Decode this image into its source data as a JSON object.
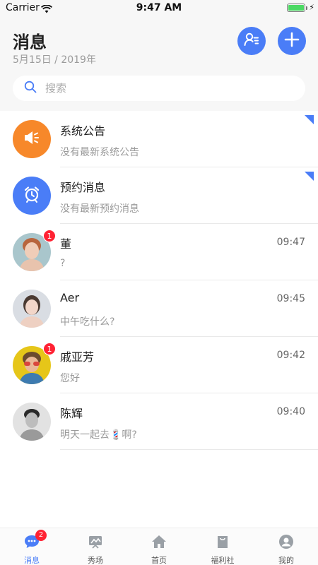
{
  "status_bar": {
    "carrier": "Carrier",
    "time": "9:47 AM"
  },
  "header": {
    "title": "消息",
    "date": "5月15日 / 2019年",
    "contacts_icon": "contacts-icon",
    "add_icon": "plus-icon",
    "accent_color": "#4a7df7"
  },
  "search": {
    "placeholder": "搜索",
    "value": ""
  },
  "conversations": [
    {
      "name": "系统公告",
      "preview": "没有最新系统公告",
      "time": "",
      "badge": "",
      "icon": "megaphone-icon",
      "avatar_color": "#f7882a",
      "corner_tag": true
    },
    {
      "name": "预约消息",
      "preview": "没有最新预约消息",
      "time": "",
      "badge": "",
      "icon": "alarm-clock-icon",
      "avatar_color": "#4a7df7",
      "corner_tag": true
    },
    {
      "name": "董",
      "preview": "?",
      "time": "09:47",
      "badge": "1",
      "icon": "user-avatar",
      "avatar_color": "#a9c6cc"
    },
    {
      "name": "Aer",
      "preview": "中午吃什么?",
      "time": "09:45",
      "badge": "",
      "icon": "user-avatar",
      "avatar_color": "#d9dde3"
    },
    {
      "name": "戚亚芳",
      "preview": "您好",
      "time": "09:42",
      "badge": "1",
      "icon": "user-avatar",
      "avatar_color": "#e6c619"
    },
    {
      "name": "陈辉",
      "preview": "明天一起去💈啊?",
      "time": "09:40",
      "badge": "",
      "icon": "user-avatar",
      "avatar_color": "#e2e2e2"
    }
  ],
  "tabbar": {
    "items": [
      {
        "label": "消息",
        "icon": "chat-bubble-icon",
        "badge": "2",
        "active": true
      },
      {
        "label": "秀场",
        "icon": "showcase-icon"
      },
      {
        "label": "首页",
        "icon": "home-icon"
      },
      {
        "label": "福利社",
        "icon": "shopping-bag-icon"
      },
      {
        "label": "我的",
        "icon": "profile-icon"
      }
    ]
  }
}
